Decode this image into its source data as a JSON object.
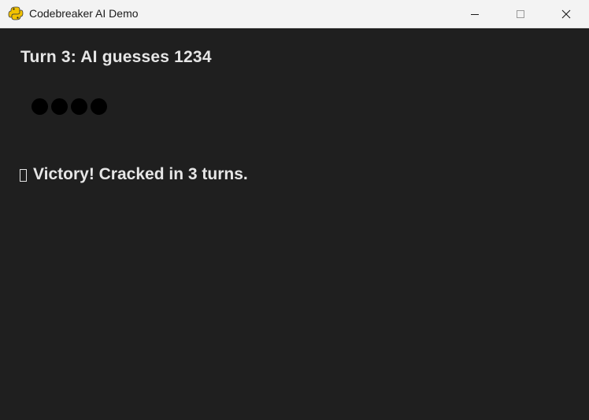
{
  "window": {
    "title": "Codebreaker AI Demo",
    "icon": "python-snake-icon",
    "controls": [
      "minimize",
      "maximize",
      "close"
    ]
  },
  "game": {
    "turn_text": "Turn 3: AI guesses 1234",
    "feedback_pegs": [
      {
        "color": "#000000"
      },
      {
        "color": "#000000"
      },
      {
        "color": "#000000"
      },
      {
        "color": "#000000"
      }
    ],
    "result_icon": "missing-glyph-icon",
    "result_text": "Victory! Cracked in 3 turns."
  },
  "colors": {
    "background": "#1f1f1f",
    "text": "#e6e6e6",
    "titlebar": "#f3f3f3",
    "peg": "#000000"
  }
}
